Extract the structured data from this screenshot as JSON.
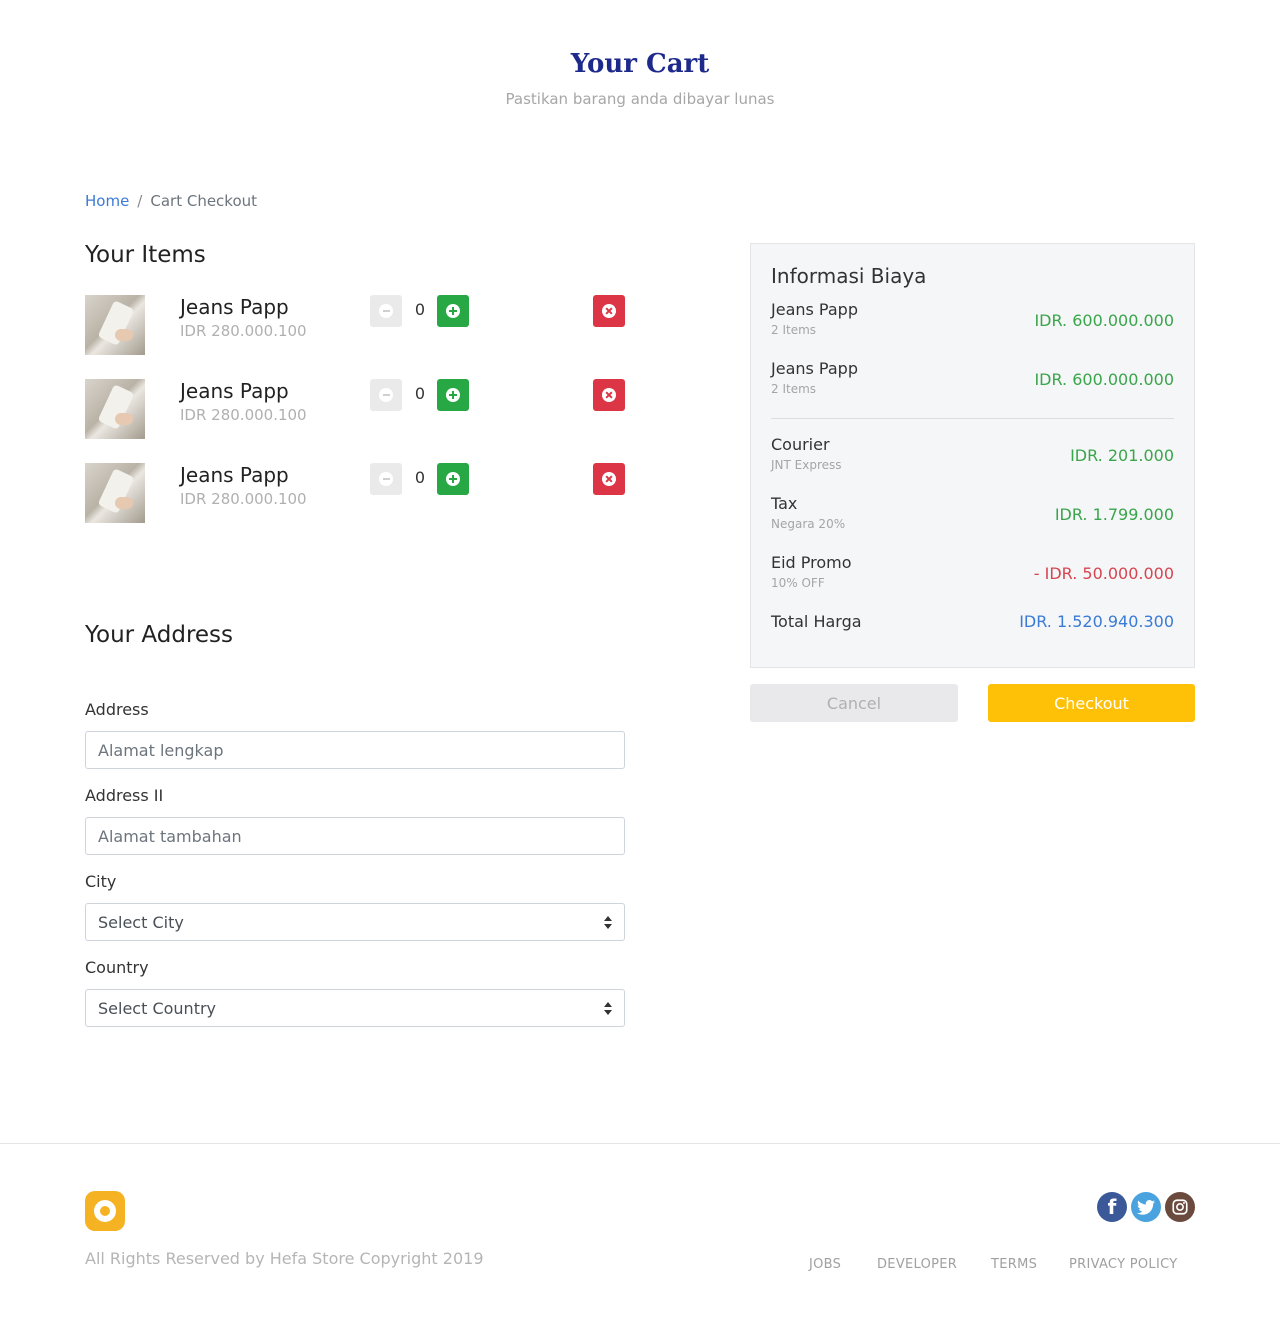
{
  "header": {
    "title": "Your Cart",
    "subtitle": "Pastikan barang anda dibayar lunas"
  },
  "breadcrumb": {
    "home": "Home",
    "separator": "/",
    "current": "Cart Checkout"
  },
  "items_section": {
    "title": "Your Items",
    "items": [
      {
        "name": "Jeans Papp",
        "price": "IDR 280.000.100",
        "quantity": "0"
      },
      {
        "name": "Jeans Papp",
        "price": "IDR 280.000.100",
        "quantity": "0"
      },
      {
        "name": "Jeans Papp",
        "price": "IDR 280.000.100",
        "quantity": "0"
      }
    ]
  },
  "address_section": {
    "title": "Your Address",
    "address": {
      "label": "Address",
      "placeholder": "Alamat lengkap"
    },
    "address2": {
      "label": "Address II",
      "placeholder": "Alamat tambahan"
    },
    "city": {
      "label": "City",
      "selected": "Select City"
    },
    "country": {
      "label": "Country",
      "selected": "Select Country"
    }
  },
  "summary": {
    "title": "Informasi Biaya",
    "lines": [
      {
        "label": "Jeans Papp",
        "sub": "2 Items",
        "value": "IDR. 600.000.000"
      },
      {
        "label": "Jeans Papp",
        "sub": "2 Items",
        "value": "IDR. 600.000.000"
      },
      {
        "label": "Courier",
        "sub": "JNT Express",
        "value": "IDR. 201.000"
      },
      {
        "label": "Tax",
        "sub": "Negara 20%",
        "value": "IDR. 1.799.000"
      },
      {
        "label": "Eid Promo",
        "sub": "10% OFF",
        "value": "- IDR. 50.000.000"
      }
    ],
    "total": {
      "label": "Total Harga",
      "value": "IDR. 1.520.940.300"
    },
    "colors": {
      "positive": "#3aa54a",
      "discount": "#d64550",
      "total": "#3a7bd5"
    }
  },
  "actions": {
    "cancel": "Cancel",
    "checkout": "Checkout"
  },
  "footer": {
    "copyright": "All Rights Reserved by Hefa Store Copyright 2019",
    "links": [
      "JOBS",
      "DEVELOPER",
      "TERMS",
      "PRIVACY POLICY"
    ],
    "social_icons": [
      "facebook-icon",
      "twitter-icon",
      "instagram-icon"
    ]
  },
  "colors": {
    "title": "#1d2a8c",
    "link": "#3a7bd5",
    "add": "#28a745",
    "remove": "#dc3545",
    "checkout": "#ffc107",
    "logo": "#f5b324"
  }
}
